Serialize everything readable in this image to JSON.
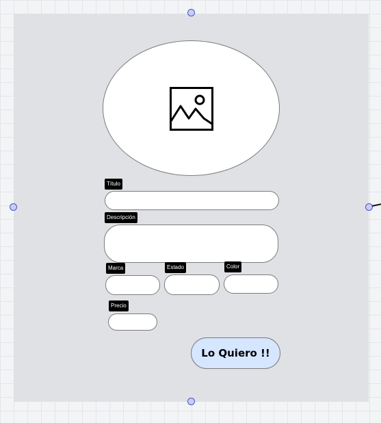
{
  "form": {
    "image_placeholder_icon": "image-icon",
    "fields": {
      "titulo": {
        "label": "Título",
        "value": ""
      },
      "descripcion": {
        "label": "Descripción",
        "value": ""
      },
      "marca": {
        "label": "Marca",
        "value": ""
      },
      "estado": {
        "label": "Estado",
        "value": ""
      },
      "color": {
        "label": "Color",
        "value": ""
      },
      "precio": {
        "label": "Precio",
        "value": ""
      }
    },
    "submit_label": "Lo Quiero !!"
  },
  "colors": {
    "canvas": "#f3f4f6",
    "frame": "#dfe1e5",
    "handle": "#c8cdf7",
    "button": "#d6e6ff"
  }
}
